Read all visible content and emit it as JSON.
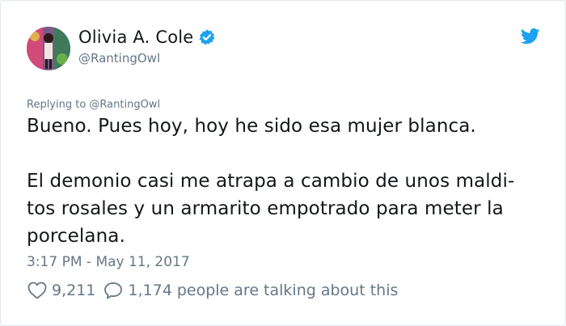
{
  "tweet": {
    "author_name": "Olivia A. Cole",
    "author_handle": "@RantingOwl",
    "replying_to": "Replying to @RantingOwl",
    "body_lines": [
      "Bueno. Pues hoy, hoy he sido esa mujer blanca.",
      "El demonio casi me atrapa a cambio de unos maldi-",
      "tos rosales y un armarito empotrado para meter la",
      "porcelana."
    ],
    "timestamp": "3:17 PM - May 11, 2017",
    "likes": "9,211",
    "talking": "1,174 people are talking about this"
  },
  "icons": {
    "verified": "verified-badge-icon",
    "twitter": "twitter-bird-icon",
    "like": "heart-icon",
    "comment": "speech-bubble-icon"
  },
  "colors": {
    "verified": "#1da1f2",
    "twitter_blue": "#1da1f2",
    "muted": "#657786",
    "text": "#14171a"
  }
}
